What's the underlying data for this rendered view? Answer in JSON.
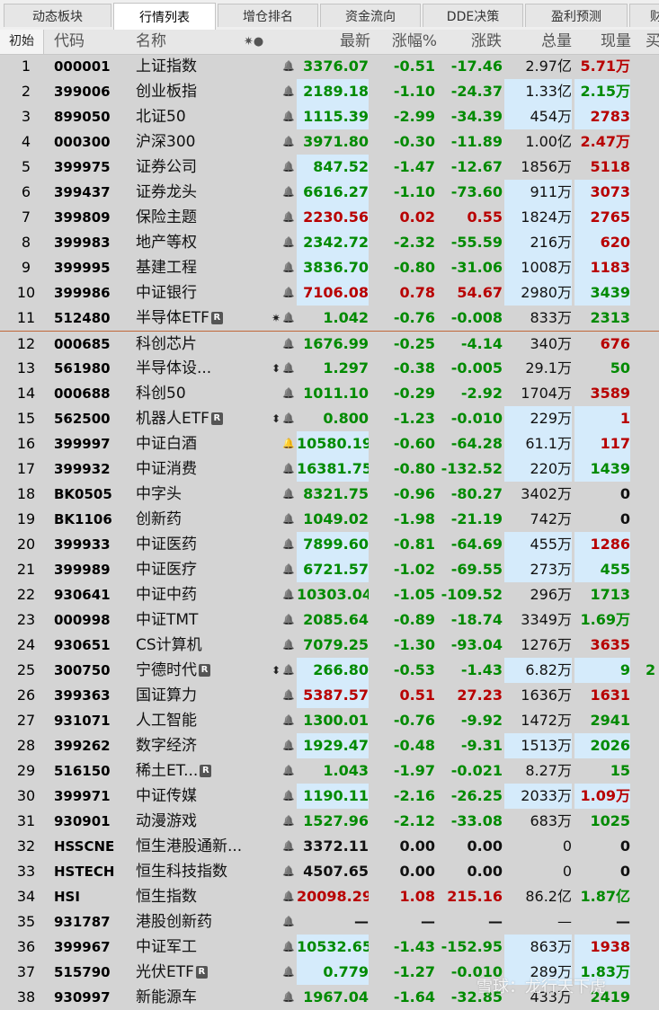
{
  "tabs": [
    {
      "label": "动态板块",
      "active": false
    },
    {
      "label": "行情列表",
      "active": true
    },
    {
      "label": "增仓排名",
      "active": false
    },
    {
      "label": "资金流向",
      "active": false
    },
    {
      "label": "DDE决策",
      "active": false
    },
    {
      "label": "盈利预测",
      "active": false
    },
    {
      "label": "财",
      "active": false
    }
  ],
  "header": {
    "sort": "初始",
    "code": "代码",
    "name": "名称",
    "flags": "✷●",
    "price": "最新",
    "chg": "涨幅%",
    "diff": "涨跌",
    "vol": "总量",
    "cur": "现量",
    "extra": "买"
  },
  "rows": [
    {
      "idx": "1",
      "code": "000001",
      "name": "上证指数",
      "badge": "",
      "flag": "",
      "bell": "normal",
      "price": "3376.07",
      "chg": "-0.51",
      "diff": "-17.46",
      "vol": "2.97亿",
      "cur": "5.71万",
      "dir": "dn",
      "cur_dir": "up",
      "hl_price": false,
      "hl_vol": false,
      "extra": ""
    },
    {
      "idx": "2",
      "code": "399006",
      "name": "创业板指",
      "badge": "",
      "flag": "",
      "bell": "normal",
      "price": "2189.18",
      "chg": "-1.10",
      "diff": "-24.37",
      "vol": "1.33亿",
      "cur": "2.15万",
      "dir": "dn",
      "cur_dir": "dn",
      "hl_price": true,
      "hl_vol": true,
      "extra": ""
    },
    {
      "idx": "3",
      "code": "899050",
      "name": "北证50",
      "badge": "",
      "flag": "",
      "bell": "normal",
      "price": "1115.39",
      "chg": "-2.99",
      "diff": "-34.39",
      "vol": "454万",
      "cur": "2783",
      "dir": "dn",
      "cur_dir": "up",
      "hl_price": true,
      "hl_vol": true,
      "extra": ""
    },
    {
      "idx": "4",
      "code": "000300",
      "name": "沪深300",
      "badge": "",
      "flag": "",
      "bell": "normal",
      "price": "3971.80",
      "chg": "-0.30",
      "diff": "-11.89",
      "vol": "1.00亿",
      "cur": "2.47万",
      "dir": "dn",
      "cur_dir": "up",
      "hl_price": false,
      "hl_vol": false,
      "extra": ""
    },
    {
      "idx": "5",
      "code": "399975",
      "name": "证券公司",
      "badge": "",
      "flag": "",
      "bell": "normal",
      "price": "847.52",
      "chg": "-1.47",
      "diff": "-12.67",
      "vol": "1856万",
      "cur": "5118",
      "dir": "dn",
      "cur_dir": "up",
      "hl_price": true,
      "hl_vol": false,
      "extra": ""
    },
    {
      "idx": "6",
      "code": "399437",
      "name": "证券龙头",
      "badge": "",
      "flag": "",
      "bell": "normal",
      "price": "6616.27",
      "chg": "-1.10",
      "diff": "-73.60",
      "vol": "911万",
      "cur": "3073",
      "dir": "dn",
      "cur_dir": "up",
      "hl_price": true,
      "hl_vol": true,
      "extra": ""
    },
    {
      "idx": "7",
      "code": "399809",
      "name": "保险主题",
      "badge": "",
      "flag": "",
      "bell": "normal",
      "price": "2230.56",
      "chg": "0.02",
      "diff": "0.55",
      "vol": "1824万",
      "cur": "2765",
      "dir": "up",
      "cur_dir": "up",
      "hl_price": true,
      "hl_vol": true,
      "extra": ""
    },
    {
      "idx": "8",
      "code": "399983",
      "name": "地产等权",
      "badge": "",
      "flag": "",
      "bell": "normal",
      "price": "2342.72",
      "chg": "-2.32",
      "diff": "-55.59",
      "vol": "216万",
      "cur": "620",
      "dir": "dn",
      "cur_dir": "up",
      "hl_price": true,
      "hl_vol": true,
      "extra": ""
    },
    {
      "idx": "9",
      "code": "399995",
      "name": "基建工程",
      "badge": "",
      "flag": "",
      "bell": "normal",
      "price": "3836.70",
      "chg": "-0.80",
      "diff": "-31.06",
      "vol": "1008万",
      "cur": "1183",
      "dir": "dn",
      "cur_dir": "up",
      "hl_price": true,
      "hl_vol": true,
      "extra": ""
    },
    {
      "idx": "10",
      "code": "399986",
      "name": "中证银行",
      "badge": "",
      "flag": "",
      "bell": "normal",
      "price": "7106.08",
      "chg": "0.78",
      "diff": "54.67",
      "vol": "2980万",
      "cur": "3439",
      "dir": "up",
      "cur_dir": "dn",
      "hl_price": true,
      "hl_vol": true,
      "extra": ""
    },
    {
      "idx": "11",
      "code": "512480",
      "name": "半导体ETF",
      "badge": "R",
      "flag": "✷",
      "bell": "normal",
      "price": "1.042",
      "chg": "-0.76",
      "diff": "-0.008",
      "vol": "833万",
      "cur": "2313",
      "dir": "dn",
      "cur_dir": "dn",
      "hl_price": false,
      "hl_vol": false,
      "extra": ""
    },
    {
      "idx": "12",
      "code": "000685",
      "name": "科创芯片",
      "badge": "",
      "flag": "",
      "bell": "normal",
      "price": "1676.99",
      "chg": "-0.25",
      "diff": "-4.14",
      "vol": "340万",
      "cur": "676",
      "dir": "dn",
      "cur_dir": "up",
      "hl_price": false,
      "hl_vol": false,
      "extra": "",
      "sep": true
    },
    {
      "idx": "13",
      "code": "561980",
      "name": "半导体设...",
      "badge": "",
      "flag": "⬍",
      "bell": "normal",
      "price": "1.297",
      "chg": "-0.38",
      "diff": "-0.005",
      "vol": "29.1万",
      "cur": "50",
      "dir": "dn",
      "cur_dir": "dn",
      "hl_price": false,
      "hl_vol": false,
      "extra": ""
    },
    {
      "idx": "14",
      "code": "000688",
      "name": "科创50",
      "badge": "",
      "flag": "",
      "bell": "normal",
      "price": "1011.10",
      "chg": "-0.29",
      "diff": "-2.92",
      "vol": "1704万",
      "cur": "3589",
      "dir": "dn",
      "cur_dir": "up",
      "hl_price": false,
      "hl_vol": false,
      "extra": ""
    },
    {
      "idx": "15",
      "code": "562500",
      "name": "机器人ETF",
      "badge": "R",
      "flag": "⬍",
      "bell": "normal",
      "price": "0.800",
      "chg": "-1.23",
      "diff": "-0.010",
      "vol": "229万",
      "cur": "1",
      "dir": "dn",
      "cur_dir": "up",
      "hl_price": false,
      "hl_vol": true,
      "extra": ""
    },
    {
      "idx": "16",
      "code": "399997",
      "name": "中证白酒",
      "badge": "",
      "flag": "",
      "bell": "red",
      "price": "10580.19",
      "chg": "-0.60",
      "diff": "-64.28",
      "vol": "61.1万",
      "cur": "117",
      "dir": "dn",
      "cur_dir": "up",
      "hl_price": true,
      "hl_vol": true,
      "extra": ""
    },
    {
      "idx": "17",
      "code": "399932",
      "name": "中证消费",
      "badge": "",
      "flag": "",
      "bell": "normal",
      "price": "16381.75",
      "chg": "-0.80",
      "diff": "-132.52",
      "vol": "220万",
      "cur": "1439",
      "dir": "dn",
      "cur_dir": "dn",
      "hl_price": true,
      "hl_vol": true,
      "extra": ""
    },
    {
      "idx": "18",
      "code": "BK0505",
      "name": "中字头",
      "badge": "",
      "flag": "",
      "bell": "normal",
      "price": "8321.75",
      "chg": "-0.96",
      "diff": "-80.27",
      "vol": "3402万",
      "cur": "0",
      "dir": "dn",
      "cur_dir": "eq",
      "hl_price": false,
      "hl_vol": false,
      "extra": ""
    },
    {
      "idx": "19",
      "code": "BK1106",
      "name": "创新药",
      "badge": "",
      "flag": "",
      "bell": "normal",
      "price": "1049.02",
      "chg": "-1.98",
      "diff": "-21.19",
      "vol": "742万",
      "cur": "0",
      "dir": "dn",
      "cur_dir": "eq",
      "hl_price": false,
      "hl_vol": false,
      "extra": ""
    },
    {
      "idx": "20",
      "code": "399933",
      "name": "中证医药",
      "badge": "",
      "flag": "",
      "bell": "normal",
      "price": "7899.60",
      "chg": "-0.81",
      "diff": "-64.69",
      "vol": "455万",
      "cur": "1286",
      "dir": "dn",
      "cur_dir": "up",
      "hl_price": true,
      "hl_vol": true,
      "extra": ""
    },
    {
      "idx": "21",
      "code": "399989",
      "name": "中证医疗",
      "badge": "",
      "flag": "",
      "bell": "normal",
      "price": "6721.57",
      "chg": "-1.02",
      "diff": "-69.55",
      "vol": "273万",
      "cur": "455",
      "dir": "dn",
      "cur_dir": "dn",
      "hl_price": true,
      "hl_vol": true,
      "extra": ""
    },
    {
      "idx": "22",
      "code": "930641",
      "name": "中证中药",
      "badge": "",
      "flag": "",
      "bell": "normal",
      "price": "10303.04",
      "chg": "-1.05",
      "diff": "-109.52",
      "vol": "296万",
      "cur": "1713",
      "dir": "dn",
      "cur_dir": "dn",
      "hl_price": false,
      "hl_vol": false,
      "extra": ""
    },
    {
      "idx": "23",
      "code": "000998",
      "name": "中证TMT",
      "badge": "",
      "flag": "",
      "bell": "normal",
      "price": "2085.64",
      "chg": "-0.89",
      "diff": "-18.74",
      "vol": "3349万",
      "cur": "1.69万",
      "dir": "dn",
      "cur_dir": "dn",
      "hl_price": false,
      "hl_vol": false,
      "extra": ""
    },
    {
      "idx": "24",
      "code": "930651",
      "name": "CS计算机",
      "badge": "",
      "flag": "",
      "bell": "normal",
      "price": "7079.25",
      "chg": "-1.30",
      "diff": "-93.04",
      "vol": "1276万",
      "cur": "3635",
      "dir": "dn",
      "cur_dir": "up",
      "hl_price": false,
      "hl_vol": false,
      "extra": ""
    },
    {
      "idx": "25",
      "code": "300750",
      "name": "宁德时代",
      "badge": "R",
      "flag": "⬍",
      "bell": "normal",
      "price": "266.80",
      "chg": "-0.53",
      "diff": "-1.43",
      "vol": "6.82万",
      "cur": "9",
      "dir": "dn",
      "cur_dir": "dn",
      "hl_price": true,
      "hl_vol": true,
      "extra": "2"
    },
    {
      "idx": "26",
      "code": "399363",
      "name": "国证算力",
      "badge": "",
      "flag": "",
      "bell": "normal",
      "price": "5387.57",
      "chg": "0.51",
      "diff": "27.23",
      "vol": "1636万",
      "cur": "1631",
      "dir": "up",
      "cur_dir": "up",
      "hl_price": true,
      "hl_vol": false,
      "extra": ""
    },
    {
      "idx": "27",
      "code": "931071",
      "name": "人工智能",
      "badge": "",
      "flag": "",
      "bell": "normal",
      "price": "1300.01",
      "chg": "-0.76",
      "diff": "-9.92",
      "vol": "1472万",
      "cur": "2941",
      "dir": "dn",
      "cur_dir": "dn",
      "hl_price": false,
      "hl_vol": false,
      "extra": ""
    },
    {
      "idx": "28",
      "code": "399262",
      "name": "数字经济",
      "badge": "",
      "flag": "",
      "bell": "normal",
      "price": "1929.47",
      "chg": "-0.48",
      "diff": "-9.31",
      "vol": "1513万",
      "cur": "2026",
      "dir": "dn",
      "cur_dir": "dn",
      "hl_price": true,
      "hl_vol": true,
      "extra": ""
    },
    {
      "idx": "29",
      "code": "516150",
      "name": "稀土ET...",
      "badge": "R",
      "flag": "",
      "bell": "normal",
      "price": "1.043",
      "chg": "-1.97",
      "diff": "-0.021",
      "vol": "8.27万",
      "cur": "15",
      "dir": "dn",
      "cur_dir": "dn",
      "hl_price": false,
      "hl_vol": false,
      "extra": ""
    },
    {
      "idx": "30",
      "code": "399971",
      "name": "中证传媒",
      "badge": "",
      "flag": "",
      "bell": "normal",
      "price": "1190.11",
      "chg": "-2.16",
      "diff": "-26.25",
      "vol": "2033万",
      "cur": "1.09万",
      "dir": "dn",
      "cur_dir": "up",
      "hl_price": true,
      "hl_vol": true,
      "extra": ""
    },
    {
      "idx": "31",
      "code": "930901",
      "name": "动漫游戏",
      "badge": "",
      "flag": "",
      "bell": "normal",
      "price": "1527.96",
      "chg": "-2.12",
      "diff": "-33.08",
      "vol": "683万",
      "cur": "1025",
      "dir": "dn",
      "cur_dir": "dn",
      "hl_price": false,
      "hl_vol": false,
      "extra": ""
    },
    {
      "idx": "32",
      "code": "HSSCNE",
      "name": "恒生港股通新...",
      "badge": "",
      "flag": "",
      "bell": "normal",
      "price": "3372.11",
      "chg": "0.00",
      "diff": "0.00",
      "vol": "0",
      "cur": "0",
      "dir": "eq",
      "cur_dir": "eq",
      "hl_price": false,
      "hl_vol": false,
      "extra": ""
    },
    {
      "idx": "33",
      "code": "HSTECH",
      "name": "恒生科技指数",
      "badge": "",
      "flag": "",
      "bell": "normal",
      "price": "4507.65",
      "chg": "0.00",
      "diff": "0.00",
      "vol": "0",
      "cur": "0",
      "dir": "eq",
      "cur_dir": "eq",
      "hl_price": false,
      "hl_vol": false,
      "extra": ""
    },
    {
      "idx": "34",
      "code": "HSI",
      "name": "恒生指数",
      "badge": "",
      "flag": "",
      "bell": "normal",
      "price": "20098.29",
      "chg": "1.08",
      "diff": "215.16",
      "vol": "86.2亿",
      "cur": "1.87亿",
      "dir": "up",
      "cur_dir": "dn",
      "hl_price": false,
      "hl_vol": false,
      "extra": ""
    },
    {
      "idx": "35",
      "code": "931787",
      "name": "港股创新药",
      "badge": "",
      "flag": "",
      "bell": "normal",
      "price": "—",
      "chg": "—",
      "diff": "—",
      "vol": "—",
      "cur": "—",
      "dir": "eq",
      "cur_dir": "eq",
      "hl_price": false,
      "hl_vol": false,
      "extra": ""
    },
    {
      "idx": "36",
      "code": "399967",
      "name": "中证军工",
      "badge": "",
      "flag": "",
      "bell": "normal",
      "price": "10532.65",
      "chg": "-1.43",
      "diff": "-152.95",
      "vol": "863万",
      "cur": "1938",
      "dir": "dn",
      "cur_dir": "up",
      "hl_price": true,
      "hl_vol": true,
      "extra": ""
    },
    {
      "idx": "37",
      "code": "515790",
      "name": "光伏ETF",
      "badge": "R",
      "flag": "",
      "bell": "normal",
      "price": "0.779",
      "chg": "-1.27",
      "diff": "-0.010",
      "vol": "289万",
      "cur": "1.83万",
      "dir": "dn",
      "cur_dir": "dn",
      "hl_price": true,
      "hl_vol": true,
      "extra": ""
    },
    {
      "idx": "38",
      "code": "930997",
      "name": "新能源车",
      "badge": "",
      "flag": "",
      "bell": "normal",
      "price": "1967.04",
      "chg": "-1.64",
      "diff": "-32.85",
      "vol": "433万",
      "cur": "2419",
      "dir": "dn",
      "cur_dir": "dn",
      "hl_price": false,
      "hl_vol": false,
      "extra": ""
    }
  ],
  "watermark": "雪球：龙行天下虎",
  "colors": {
    "up": "#b80000",
    "down": "#008a00",
    "highlight": "#d5ebfb"
  }
}
